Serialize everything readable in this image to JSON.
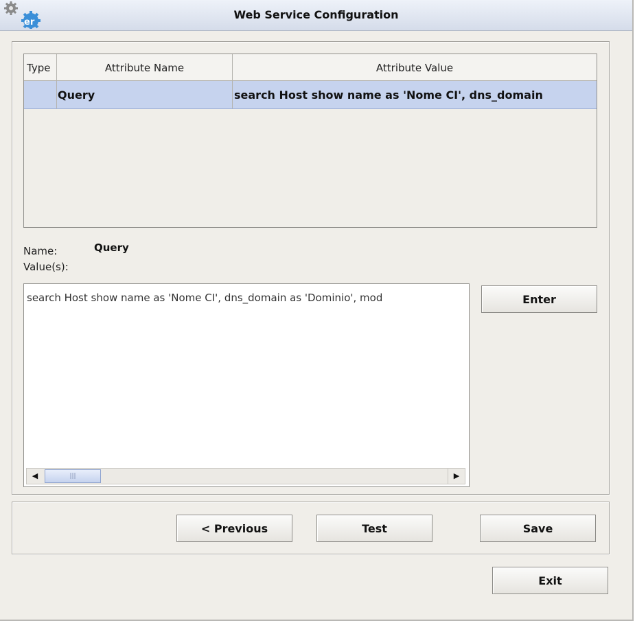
{
  "window": {
    "title": "Web Service Configuration",
    "icon": "gear-er-icon"
  },
  "table": {
    "columns": [
      "Type",
      "Attribute Name",
      "Attribute Value"
    ],
    "rows": [
      {
        "type": "",
        "name": "Query",
        "value": "search Host show name as 'Nome CI', dns_domain"
      }
    ],
    "selected_row_color": "#c6d3ee"
  },
  "detail": {
    "name_label": "Name:",
    "name_value": "Query",
    "values_label": "Value(s):",
    "values_text": "search Host show name as 'Nome CI', dns_domain as 'Dominio', mod"
  },
  "buttons": {
    "enter": "Enter",
    "previous": "< Previous",
    "test": "Test",
    "save": "Save",
    "exit": "Exit"
  },
  "scrollbar": {
    "left_icon": "arrow-left-icon",
    "right_icon": "arrow-right-icon",
    "thumb_grip": "|||"
  }
}
